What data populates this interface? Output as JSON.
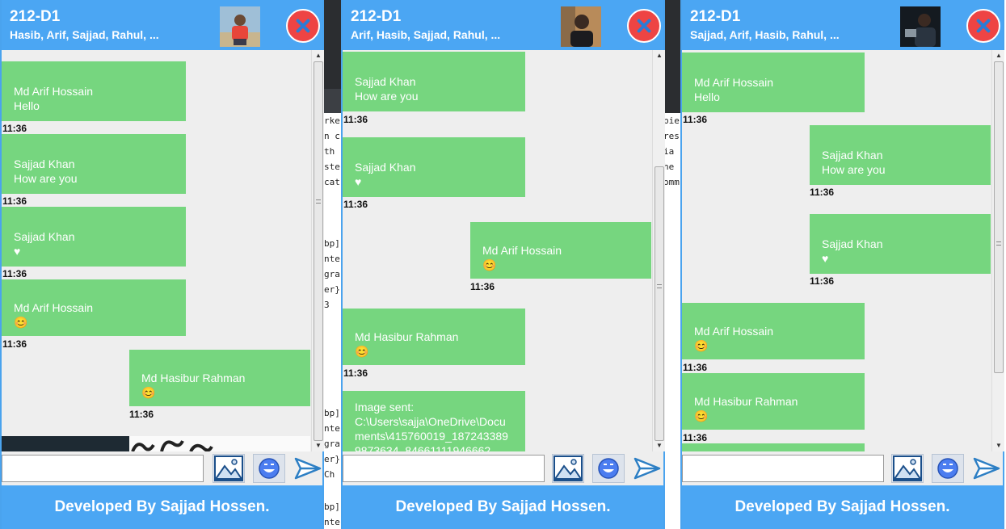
{
  "windows": [
    {
      "title": "212-D1",
      "members": "Hasib, Arif, Sajjad, Rahul, ...",
      "messages": [
        {
          "sender": "Md Arif Hossain",
          "body": "Hello",
          "time": "11:36"
        },
        {
          "sender": "Sajjad Khan",
          "body": "How are you",
          "time": "11:36"
        },
        {
          "sender": "Sajjad Khan",
          "body": "♥",
          "time": "11:36"
        },
        {
          "sender": "Md Arif Hossain",
          "body": "😊",
          "time": "11:36"
        },
        {
          "sender": "Md Hasibur Rahman",
          "body": "😊",
          "time": "11:36"
        }
      ],
      "footer": "Developed By Sajjad Hossen."
    },
    {
      "title": "212-D1",
      "members": "Arif, Hasib, Sajjad, Rahul, ...",
      "messages": [
        {
          "sender": "Sajjad Khan",
          "body": "How are you",
          "time": "11:36"
        },
        {
          "sender": "Sajjad Khan",
          "body": "♥",
          "time": "11:36"
        },
        {
          "sender": "Md Arif Hossain",
          "body": "😊",
          "time": "11:36"
        },
        {
          "sender": "Md Hasibur Rahman",
          "body": "😊",
          "time": "11:36"
        },
        {
          "sender": "Image sent:",
          "body": "C:\\Users\\sajja\\OneDrive\\Documents\\415760019_1872433899873634_84661111946662"
        }
      ],
      "footer": "Developed By Sajjad Hossen."
    },
    {
      "title": "212-D1",
      "members": "Sajjad, Arif, Hasib, Rahul, ...",
      "messages": [
        {
          "sender": "Md Arif Hossain",
          "body": "Hello",
          "time": "11:36"
        },
        {
          "sender": "Sajjad Khan",
          "body": "How are you",
          "time": "11:36"
        },
        {
          "sender": "Sajjad Khan",
          "body": "♥",
          "time": "11:36"
        },
        {
          "sender": "Md Arif Hossain",
          "body": "😊",
          "time": "11:36"
        },
        {
          "sender": "Md Hasibur Rahman",
          "body": "😊",
          "time": "11:36"
        }
      ],
      "footer": "Developed By Sajjad Hossen."
    }
  ],
  "colors": {
    "header": "#4ba6f3",
    "bubble": "#76d67f",
    "close": "#ee4444"
  },
  "icons": [
    "photo-icon",
    "emoji-icon",
    "send-icon",
    "close-icon"
  ]
}
